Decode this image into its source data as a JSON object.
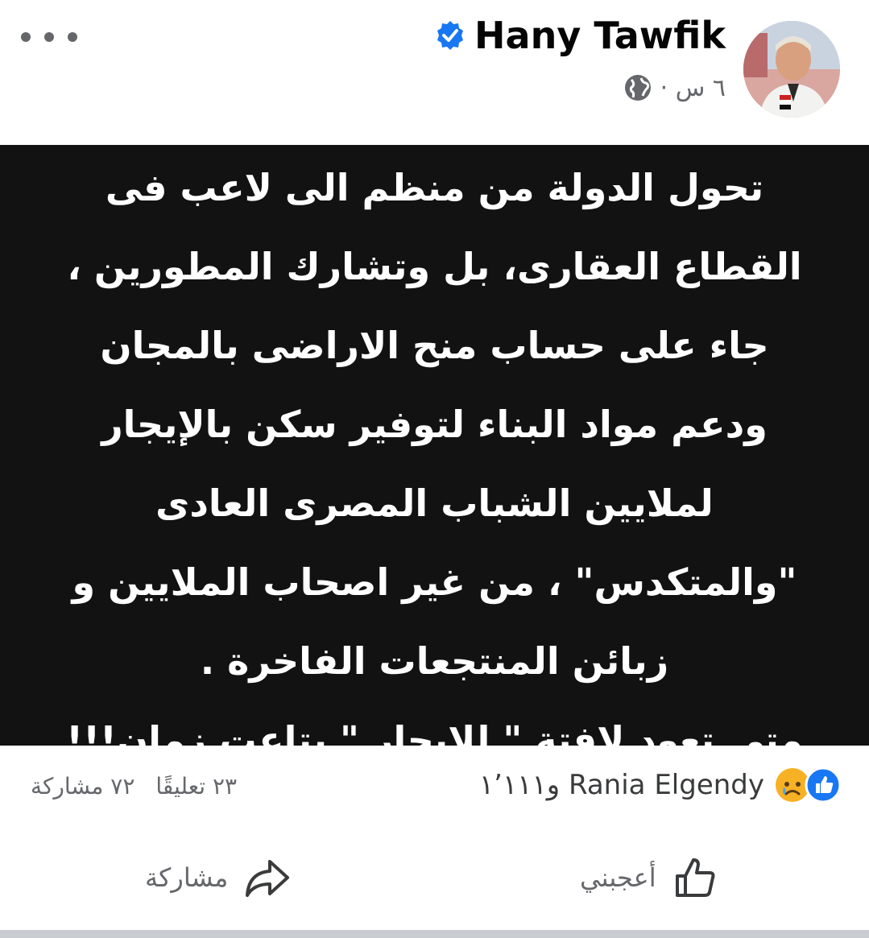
{
  "post": {
    "author": "Hany Tawfik",
    "time": "٦ س ·",
    "text_lines": [
      "تحول الدولة من منظم الى لاعب فى",
      "القطاع العقارى، بل وتشارك المطورين ،",
      "جاء على حساب منح الاراضى بالمجان",
      "ودعم مواد البناء لتوفير سكن بالإيجار",
      "لملايين الشباب المصرى العادى",
      "\"والمتكدس\" ، من غير اصحاب الملايين و",
      "زبائن المنتجعات الفاخرة .",
      "متى تعود لافتة \" للايجار \" بتاعت زمان!!!"
    ]
  },
  "reactions": {
    "summary": "Rania Elgendy و١٬١١١",
    "types": [
      "like-icon",
      "sad-icon"
    ]
  },
  "counts": {
    "comments": "٢٣ تعليقًا",
    "shares": "٧٢ مشاركة"
  },
  "actions": {
    "like": "أعجبني",
    "share": "مشاركة"
  },
  "colors": {
    "verified": "#1877f2",
    "like_blue": "#1877f2",
    "muted": "#65676b",
    "post_bg": "#121212"
  }
}
